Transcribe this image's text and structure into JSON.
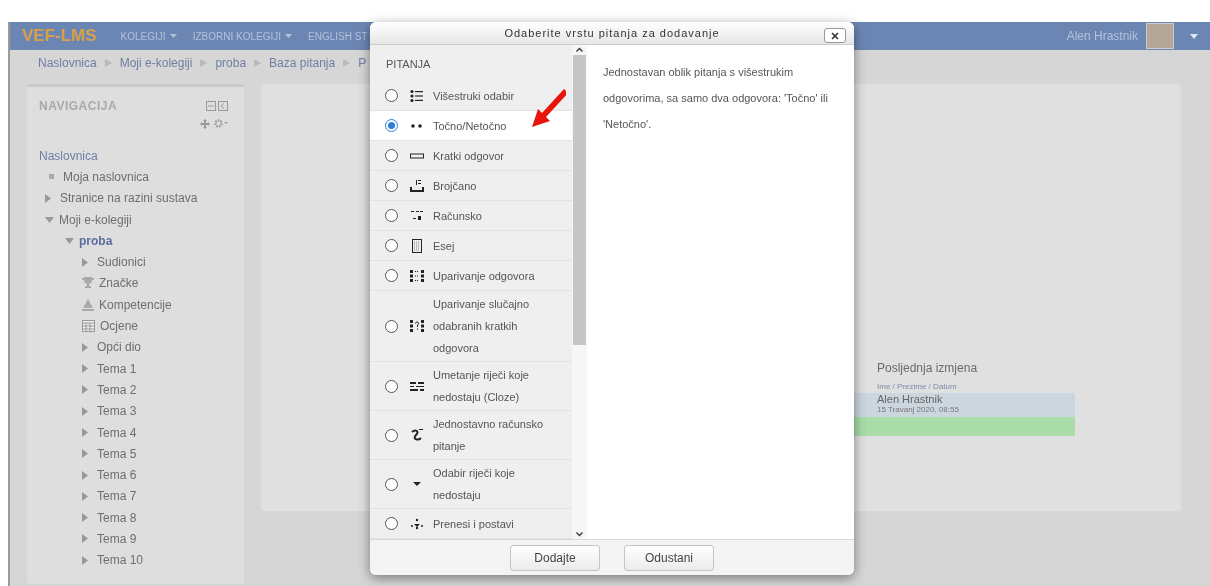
{
  "navbar": {
    "brand": "VEF-LMS",
    "menus": [
      {
        "label": "KOLEGIJI",
        "dropdown": true
      },
      {
        "label": "IZBORNI KOLEGIJI",
        "dropdown": true
      },
      {
        "label": "ENGLISH ST",
        "dropdown": false
      }
    ],
    "user": "Alen Hrastnik"
  },
  "breadcrumb": [
    "Naslovnica",
    "Moji e-kolegiji",
    "proba",
    "Baza pitanja",
    "P"
  ],
  "sidebar": {
    "title": "NAVIGACIJA",
    "tree": [
      {
        "label": "Naslovnica",
        "kind": "heading",
        "selected": false,
        "children": [
          {
            "label": "Moja naslovnica",
            "kind": "leaf",
            "selected": false
          },
          {
            "label": "Stranice na razini sustava",
            "kind": "branch",
            "expanded": false,
            "selected": false
          },
          {
            "label": "Moji e-kolegiji",
            "kind": "branch",
            "expanded": true,
            "selected": false,
            "children": [
              {
                "label": "proba",
                "kind": "branch",
                "expanded": true,
                "selected": true,
                "children": [
                  {
                    "label": "Sudionici",
                    "kind": "branch",
                    "expanded": false,
                    "selected": false
                  },
                  {
                    "label": "Značke",
                    "kind": "trophy",
                    "selected": false
                  },
                  {
                    "label": "Kompetencije",
                    "kind": "competency",
                    "selected": false
                  },
                  {
                    "label": "Ocjene",
                    "kind": "grades",
                    "selected": false
                  },
                  {
                    "label": "Opći dio",
                    "kind": "branch",
                    "expanded": false,
                    "selected": false
                  },
                  {
                    "label": "Tema 1",
                    "kind": "branch",
                    "expanded": false,
                    "selected": false
                  },
                  {
                    "label": "Tema 2",
                    "kind": "branch",
                    "expanded": false,
                    "selected": false
                  },
                  {
                    "label": "Tema 3",
                    "kind": "branch",
                    "expanded": false,
                    "selected": false
                  },
                  {
                    "label": "Tema 4",
                    "kind": "branch",
                    "expanded": false,
                    "selected": false
                  },
                  {
                    "label": "Tema 5",
                    "kind": "branch",
                    "expanded": false,
                    "selected": false
                  },
                  {
                    "label": "Tema 6",
                    "kind": "branch",
                    "expanded": false,
                    "selected": false
                  },
                  {
                    "label": "Tema 7",
                    "kind": "branch",
                    "expanded": false,
                    "selected": false
                  },
                  {
                    "label": "Tema 8",
                    "kind": "branch",
                    "expanded": false,
                    "selected": false
                  },
                  {
                    "label": "Tema 9",
                    "kind": "branch",
                    "expanded": false,
                    "selected": false
                  },
                  {
                    "label": "Tema 10",
                    "kind": "branch",
                    "expanded": false,
                    "selected": false
                  }
                ]
              }
            ]
          }
        ]
      }
    ]
  },
  "main": {
    "heading": "Posljednja izmjena",
    "subheading": "Ime / Prezime / Datum",
    "rows": [
      {
        "name": "Alen Hrastnik",
        "date": "15 Travanj 2020, 08:55",
        "color": "#ccd6df"
      },
      {
        "name": "",
        "date": "",
        "color": "#a9dca9"
      }
    ]
  },
  "dialog": {
    "title": "Odaberite vrstu pitanja za dodavanje",
    "section": "PITANJA",
    "options": [
      {
        "label": "Višestruki odabir",
        "kind": "multichoice",
        "selected": false
      },
      {
        "label": "Točno/Netočno",
        "kind": "truefalse",
        "selected": true
      },
      {
        "label": "Kratki odgovor",
        "kind": "shortanswer",
        "selected": false
      },
      {
        "label": "Brojčano",
        "kind": "numerical",
        "selected": false
      },
      {
        "label": "Računsko",
        "kind": "calculated",
        "selected": false
      },
      {
        "label": "Esej",
        "kind": "essay",
        "selected": false
      },
      {
        "label": "Uparivanje odgovora",
        "kind": "match",
        "selected": false
      },
      {
        "label": "Uparivanje slučajno odabranih kratkih odgovora",
        "kind": "randomsamatch",
        "selected": false
      },
      {
        "label": "Umetanje riječi koje nedostaju (Cloze)",
        "kind": "multianswer",
        "selected": false
      },
      {
        "label": "Jednostavno računsko pitanje",
        "kind": "calculatedsimple",
        "selected": false
      },
      {
        "label": "Odabir riječi koje nedostaju",
        "kind": "gapselect",
        "selected": false
      },
      {
        "label": "Prenesi i postavi",
        "kind": "ddwtos",
        "selected": false
      }
    ],
    "description": "Jednostavan oblik pitanja s višestrukim odgovorima, sa samo dva odgovora: 'Točno' ili 'Netočno'.",
    "buttons": [
      "Dodajte",
      "Odustani"
    ]
  }
}
